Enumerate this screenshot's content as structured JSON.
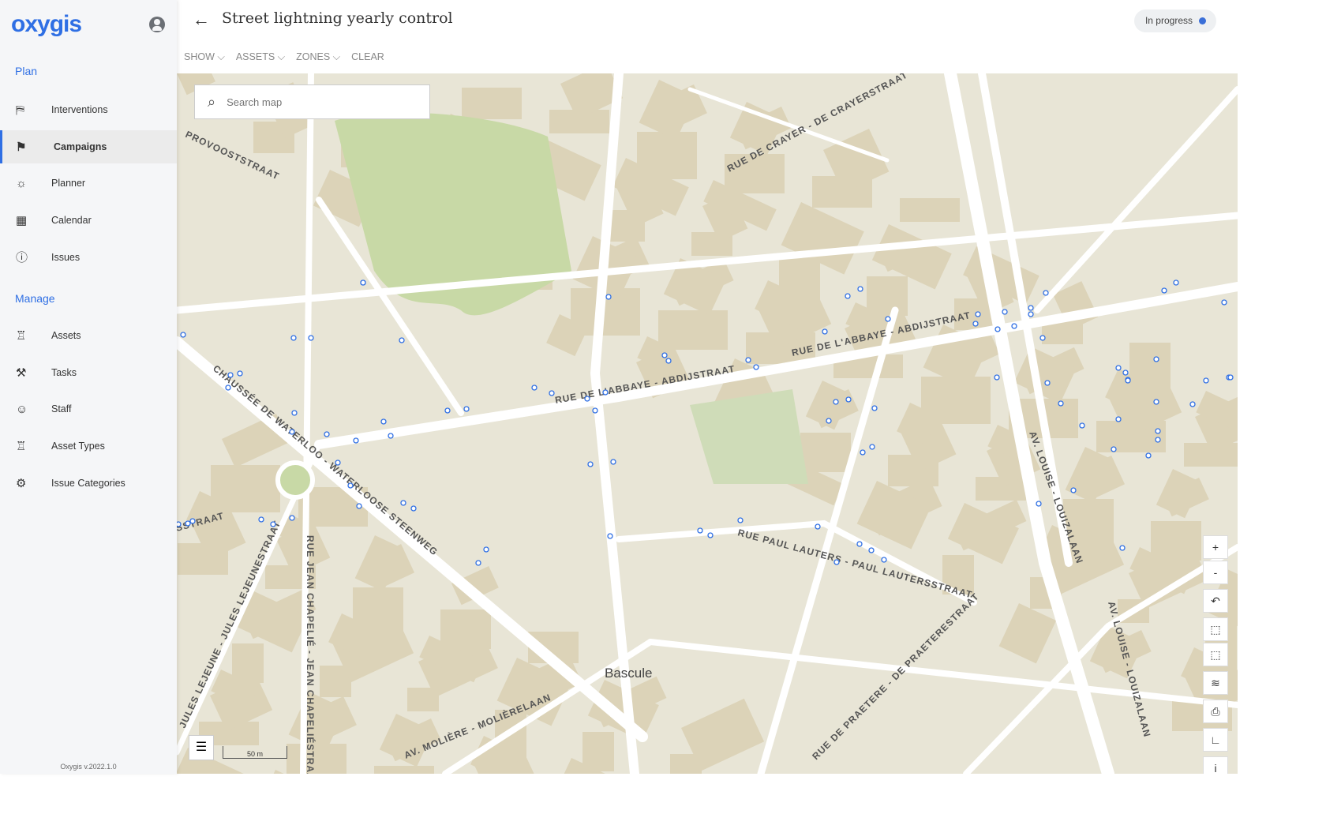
{
  "app": {
    "logo": "oxygis",
    "version": "Oxygis v.2022.1.0"
  },
  "sidebar": {
    "plan_label": "Plan",
    "plan_items": [
      {
        "label": "Interventions",
        "icon": "map-icon"
      },
      {
        "label": "Campaigns",
        "icon": "flag-icon",
        "active": true
      },
      {
        "label": "Planner",
        "icon": "lightbulb-icon"
      },
      {
        "label": "Calendar",
        "icon": "calendar-icon"
      },
      {
        "label": "Issues",
        "icon": "alert-bubble-icon"
      }
    ],
    "manage_label": "Manage",
    "manage_items": [
      {
        "label": "Assets",
        "icon": "streetlight-icon"
      },
      {
        "label": "Tasks",
        "icon": "shovel-icon"
      },
      {
        "label": "Staff",
        "icon": "worker-icon"
      },
      {
        "label": "Asset Types",
        "icon": "streetlight-icon"
      },
      {
        "label": "Issue Categories",
        "icon": "gear-icon"
      }
    ]
  },
  "header": {
    "title": "Street lightning yearly control",
    "status": "In progress",
    "status_color": "#3b6fd8",
    "menu": [
      "SHOW",
      "ASSETS",
      "ZONES",
      "CLEAR"
    ]
  },
  "map": {
    "search_placeholder": "Search map",
    "scale": "50 m",
    "controls": [
      "+",
      "-",
      "↶",
      "⬚",
      "⬚",
      "≋",
      "⎙",
      "∟",
      "i"
    ],
    "labels": [
      "PROVOOSTSTRAAT",
      "RUE DE CRAYER - DE CRAYERSTRAAT",
      "RUE DE L'ABBAYE - ABDIJSTRAAT",
      "RUE DE L'ABBAYE - ABDIJSTRAAT",
      "CHAUSSÉE DE WATERLOO - WATERLOOSE STEENWEG",
      "AV. LOUISE - LOUIZALAAN",
      "AV. LOUISE - LOUIZALAAN",
      "RUE PAUL LAUTERS - PAUL LAUTERSSTRAAT",
      "RUE JEAN CHAPELIÉ - JEAN CHAPELIÉSTRAAT",
      "JULES LEJEUNE - JULES LEJEUNESTRAAT",
      "AV. MOLIÈRE - MOLIÈRELAAN",
      "RUE DE PRAETERE - DE PRAETERESTRAAT",
      "Bascule",
      "SSTRAAT"
    ],
    "asset_marker_color": "#2f6fe4"
  }
}
